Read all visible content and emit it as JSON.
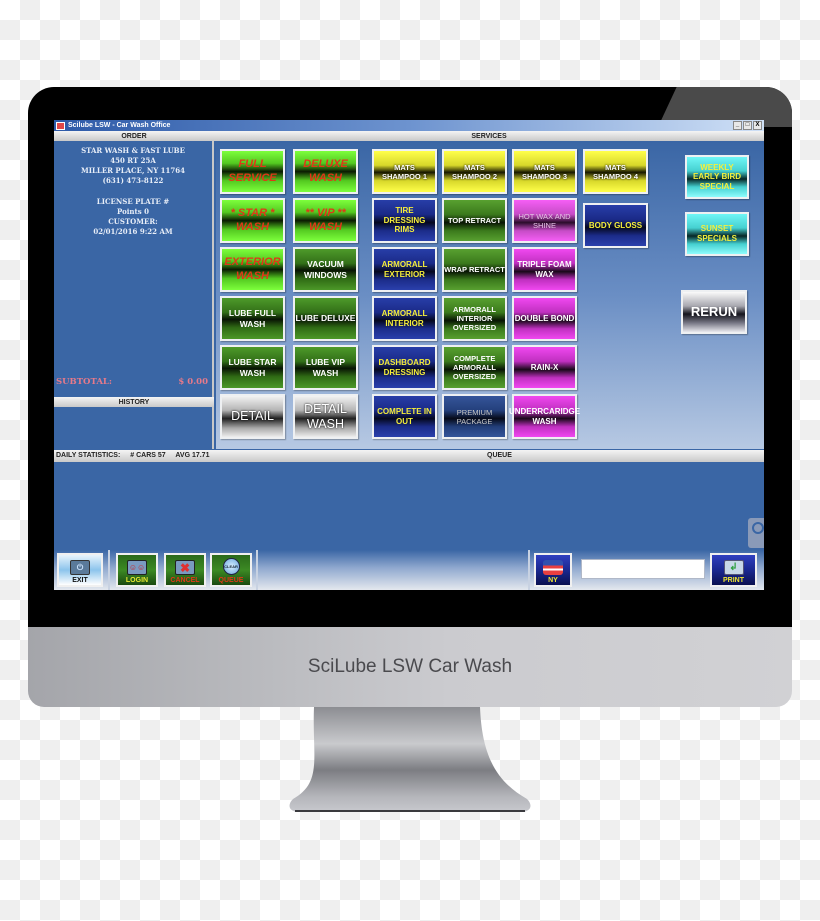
{
  "app": {
    "title": "Scilube LSW - Car Wash Office",
    "window_controls": [
      "_",
      "□",
      "X"
    ]
  },
  "monitor": {
    "brand_text": "SciLube LSW Car Wash"
  },
  "order": {
    "header": "ORDER",
    "business_name": "STAR WASH & FAST LUBE",
    "address1": "450 RT 25A",
    "address2": "MILLER PLACE, NY 11764",
    "phone": "(631) 473-8122",
    "license_plate": "LICENSE PLATE #",
    "points": "Points 0",
    "customer": "CUSTOMER:",
    "datetime": "02/01/2016 9:22 AM",
    "subtotal_label": "SUBTOTAL:",
    "subtotal_value": "$ 0.00"
  },
  "history": {
    "header": "HISTORY"
  },
  "services": {
    "header": "SERVICES",
    "wash_buttons": [
      {
        "label": "FULL SERVICE",
        "style": "green-lime"
      },
      {
        "label": "DELUXE WASH",
        "style": "green-lime"
      },
      {
        "label": "* STAR * WASH",
        "style": "green-lime"
      },
      {
        "label": "** VIP ** WASH",
        "style": "green-lime"
      },
      {
        "label": "EXTERIOR WASH",
        "style": "green-lime"
      },
      {
        "label": "VACUUM WINDOWS",
        "style": "green-dark"
      },
      {
        "label": "LUBE FULL WASH",
        "style": "green-dark"
      },
      {
        "label": "LUBE DELUXE",
        "style": "green-dark"
      },
      {
        "label": "LUBE STAR WASH",
        "style": "green-dark"
      },
      {
        "label": "LUBE VIP WASH",
        "style": "green-dark"
      },
      {
        "label": "DETAIL",
        "style": "gray"
      },
      {
        "label": "DETAIL WASH",
        "style": "gray"
      }
    ],
    "addon_buttons": [
      {
        "label": "MATS SHAMPOO 1",
        "style": "yellow"
      },
      {
        "label": "MATS SHAMPOO 2",
        "style": "yellow"
      },
      {
        "label": "MATS SHAMPOO 3",
        "style": "yellow"
      },
      {
        "label": "MATS SHAMPOO 4",
        "style": "yellow"
      },
      {
        "label": "TIRE DRESSING RIMS",
        "style": "navy"
      },
      {
        "label": "TOP RETRACT",
        "style": "forest"
      },
      {
        "label": "HOT WAX AND SHINE",
        "style": "magenta-light"
      },
      {
        "label": "BODY GLOSS",
        "style": "navy"
      },
      {
        "label": "ARMORALL EXTERIOR",
        "style": "navy"
      },
      {
        "label": "WRAP RETRACT",
        "style": "forest"
      },
      {
        "label": "TRIPLE FOAM WAX",
        "style": "magenta"
      },
      {
        "label": "ARMORALL INTERIOR",
        "style": "navy"
      },
      {
        "label": "ARMORALL INTERIOR OVERSIZED",
        "style": "forest"
      },
      {
        "label": "DOUBLE BOND",
        "style": "magenta"
      },
      {
        "label": "DASHBOARD DRESSING",
        "style": "navy"
      },
      {
        "label": "COMPLETE ARMORALL OVERSIZED",
        "style": "forest"
      },
      {
        "label": "RAIN-X",
        "style": "magenta"
      },
      {
        "label": "COMPLETE IN OUT",
        "style": "navy"
      },
      {
        "label": "PREMIUM PACKAGE",
        "style": "navy-premium"
      },
      {
        "label": "UNDERRCARIDGE WASH",
        "style": "magenta"
      }
    ],
    "specials": [
      {
        "label": "WEEKLY EARLY BIRD SPECIAL",
        "style": "cyan"
      },
      {
        "label": "SUNSET SPECIALS",
        "style": "cyan"
      }
    ],
    "rerun_label": "RERUN"
  },
  "stats": {
    "label": "DAILY STATISTICS:",
    "cars": "# CARS  57",
    "avg": "AVG  17.71",
    "queue_header": "QUEUE"
  },
  "toolbar": {
    "exit": "EXIT",
    "login": "LOGIN",
    "cancel": "CANCEL",
    "queue": "QUEUE",
    "clear_badge": "CLEAR",
    "state": "NY",
    "search_value": "",
    "print": "PRINT"
  },
  "colors": {
    "app_blue": "#3a66a5",
    "cancel_red": "#e03818",
    "label_yellow": "#f6ee3a",
    "subtotal_pink": "#e77a8a"
  }
}
